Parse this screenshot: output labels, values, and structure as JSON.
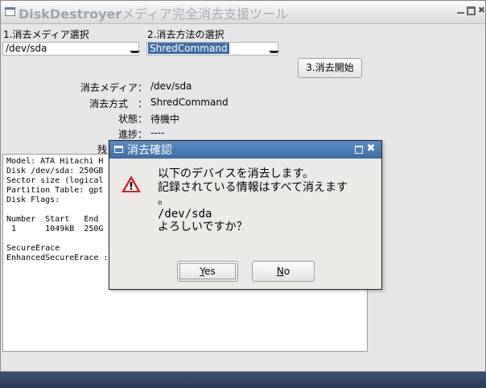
{
  "window": {
    "title_main": "DiskDestroyer",
    "title_sub": "メディア完全消去支援ツール"
  },
  "controls": {
    "media_label": "1.消去メディア選択",
    "media_value": "/dev/sda",
    "method_label": "2.消去方法の選択",
    "method_value": "ShredCommand",
    "start_label": "3.消去開始"
  },
  "info": {
    "media_key": "消去メディア：",
    "media_val": "/dev/sda",
    "method_key": "消去方式　：",
    "method_val": "ShredCommand",
    "status_key": "状態：",
    "status_val": "待機中",
    "progress_key": "進捗：",
    "progress_val": "----",
    "remaining_key": "残"
  },
  "output": {
    "lines": [
      "Model: ATA Hitachi H",
      "Disk /dev/sda: 250GB",
      "Sector size (logical",
      "Partition Table: gpt",
      "Disk Flags:",
      "",
      "Number  Start   End",
      " 1      1049kB  250G",
      "",
      "SecureErace",
      "EnhancedSecureErace : 非対応"
    ]
  },
  "dialog": {
    "title": "消去確認",
    "message_line1": "以下のデバイスを消去します。",
    "message_line2": "記録されている情報はすべて消えます",
    "message_line3": "。",
    "message_line4": "/dev/sda",
    "message_line5": "よろしいですか？",
    "yes_mnemonic": "Y",
    "yes_rest": "es",
    "no_mnemonic": "N",
    "no_rest": "o"
  },
  "colors": {
    "accent": "#3e6da6",
    "dialog_title_bar": "#4a7db8",
    "warning_red": "#d3232c",
    "window_bg": "#e6e6e6"
  },
  "icons": {
    "app": "window-icon",
    "warning": "warning-triangle-icon",
    "close": "close-icon",
    "maximize": "maximize-icon",
    "minimize": "minimize-icon",
    "dropdown": "chevron-down-icon"
  }
}
